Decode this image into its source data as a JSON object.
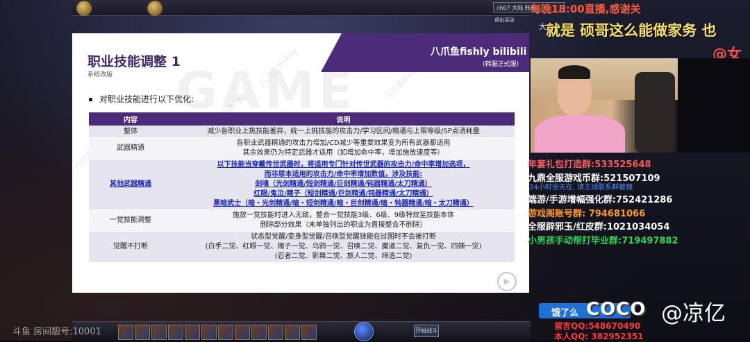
{
  "game": {
    "server_label": "ch07 大陆 韩服",
    "exit_label": "退出活动",
    "mini_button": "开始战斗"
  },
  "slide": {
    "banner_title": "八爪鱼fishly bilibili",
    "banner_subtitle": "(韩服正式服)",
    "title": "职业技能调整 1",
    "subtitle": "系统改版",
    "watermark": "GAME",
    "bullet": "对职业技能进行以下优化:",
    "table": {
      "headers": [
        "内容",
        "说明"
      ],
      "rows": [
        {
          "name": "整体",
          "lines": [
            "减少各职业上挑技能差异，统一上挑技能的攻击力/学习区间/精通与上限等级/SP点消耗量"
          ]
        },
        {
          "name": "武器精通",
          "lines": [
            "各职业武器精通的攻击力增加/CD减少等重要效果变为所有武器都适用",
            "其余效果仍为特定武器才适用（如增加命中率，增加施放速度等）"
          ]
        },
        {
          "name": "其他武器精通",
          "special": true,
          "lines": [
            "以下技能当穿戴传世武器时，将适用专门针对传世武器的攻击力/命中率增加选项，",
            "而非原本适用的攻击力/命中率增加数值，涉及技能:",
            "剑魂（光剑精通/短剑精通/巨剑精通/钝器精通/太刀精通）",
            "红眼/鬼泣/瞎子（短剑精通/巨剑精通/钝器精通/太刀精通）",
            "黑暗武士（暗・光剑精通/暗・短剑精通/暗・巨剑精通/暗・钝器精通/暗・太刀精通）"
          ]
        },
        {
          "name": "一觉技能调整",
          "lines": [
            "施放一觉技能时进入无敌，整合一觉技能3级、6级、9级特效至技能本体",
            "删除部分效果（未单独列出的职业为直接整合不删除）"
          ]
        },
        {
          "name": "觉醒不打断",
          "lines": [
            "状态型觉醒/变身型觉醒/召唤型觉醒技能在过图时不会被打断",
            "(白手二觉、红眼一觉、赌子一觉、乌鸦一觉、召唤二觉、魔道二觉、复仇一觉、四姨一觉)",
            "(忍者二觉、影舞二觉、旅人二觉、缔造二觉)"
          ]
        }
      ]
    }
  },
  "overlay": {
    "notice_top": "每晚18:00直播,感谢关",
    "notice_mid": "大",
    "marquee_1": "就是 硕哥这么能做家务 也",
    "marquee_2": "@女",
    "groups": [
      {
        "text": "年套礼包打造群:533525648",
        "color": "#ff5a5a"
      },
      {
        "text": "九鼎全服游戏币群:521507109",
        "color": "#ffffff"
      },
      {
        "sub": "24小时全天在, 请主动联系群管理"
      },
      {
        "text": "端游/手游增幅强化群:752421286",
        "color": "#ffffff"
      },
      {
        "text": "游戏阁账号群: 794681066",
        "color": "#ff9a2a"
      },
      {
        "text": "全服辟邪玉/红皮群:1021034054",
        "color": "#ffffff"
      },
      {
        "text": "小男孩手动帮打毕业群:719497882",
        "color": "#2fd45a"
      }
    ],
    "danmu": "饿了么",
    "ad_logo": "COCO",
    "ad_handle": "@凉亿",
    "qq_msg": "留言QQ:548670490",
    "qq_self": "本人QQ: 382952351",
    "room": "斗鱼 房间靓号:10001"
  }
}
